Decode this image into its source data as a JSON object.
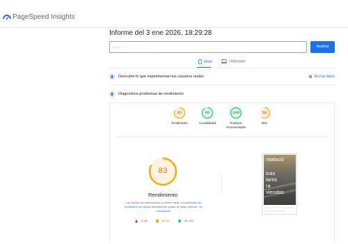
{
  "header": {
    "brand": "PageSpeed Insights"
  },
  "report": {
    "title": "Informe del 3 ene 2026, 18:29:28"
  },
  "search": {
    "url_value": "https://............................",
    "analyze_label": "Analizar"
  },
  "tabs": [
    {
      "label": "Móvil",
      "active": true,
      "icon": "phone-icon"
    },
    {
      "label": "Ordenador",
      "active": false,
      "icon": "laptop-icon"
    }
  ],
  "field_data": {
    "title": "Descubre lo que experimentan tus usuarios reales",
    "no_data": "No hay datos"
  },
  "diagnose": {
    "title": "Diagnostica problemas de rendimiento"
  },
  "scores": [
    {
      "label": "Rendimiento",
      "value": "83",
      "score": 83,
      "color": "#ffa400"
    },
    {
      "label": "Accesibilidad",
      "value": "92",
      "score": 92,
      "color": "#0cce6b"
    },
    {
      "label": "Prácticas recomendadas",
      "value": "100",
      "score": 100,
      "color": "#0cce6b"
    },
    {
      "label": "SEO",
      "value": "58",
      "score": 58,
      "color": "#ffa400"
    }
  ],
  "performance": {
    "value": "83",
    "score": 83,
    "label": "Rendimiento",
    "desc_part1": "Los valores son estimaciones y pueden variar. La ",
    "desc_link1": "puntuación del rendimiento se calcula",
    "desc_part2": " directamente a partir de estas métricas. ",
    "desc_link2": "Ver calculadora."
  },
  "legend": [
    {
      "label": "0–49",
      "icon": "fail-triangle-icon",
      "color": "#c5221f"
    },
    {
      "label": "50–89",
      "icon": "average-square-icon",
      "color": "#e37400"
    },
    {
      "label": "90–100",
      "icon": "pass-circle-icon",
      "color": "#188038"
    }
  ],
  "screenshot": {
    "lines": [
      "ntalació",
      "icas",
      "lares",
      "ra",
      "viendas"
    ]
  },
  "colors": {
    "accent": "#1a73e8",
    "average": "#ffa400",
    "pass": "#0cce6b",
    "fail": "#ff4e42"
  }
}
